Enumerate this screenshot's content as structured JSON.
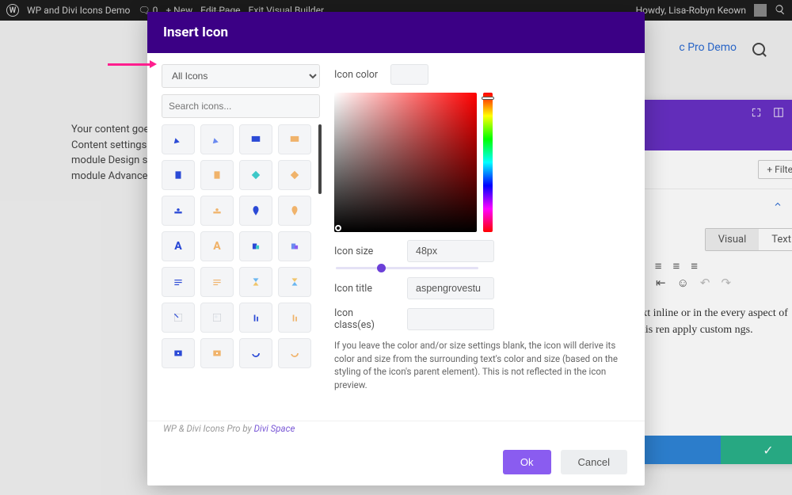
{
  "wpbar": {
    "site_title": "WP and Divi Icons Demo",
    "comments": "0",
    "new": "New",
    "edit_page": "Edit Page",
    "exit_vb": "Exit Visual Builder",
    "howdy": "Howdy, Lisa-Robyn Keown"
  },
  "page": {
    "demo_link": "c Pro Demo",
    "hint1": "Your content goe",
    "hint2": "Content settings.",
    "hint3": "module Design se",
    "hint4": "module Advance"
  },
  "editor": {
    "filter": "Filter",
    "tab_visual": "Visual",
    "tab_text": "Text",
    "body": "ext inline or in the every aspect of this ren apply custom ngs."
  },
  "modal": {
    "title": "Insert Icon",
    "category": "All Icons",
    "search_placeholder": "Search icons...",
    "label_color": "Icon color",
    "label_size": "Icon size",
    "size_value": "48px",
    "label_title": "Icon title",
    "title_value": "aspengrovestu",
    "label_classes": "Icon class(es)",
    "help": "If you leave the color and/or size settings blank, the icon will derive its color and size from the surrounding text's color and size (based on the styling of the icon's parent element). This is not reflected in the icon preview.",
    "credit_prefix": "WP & Divi Icons Pro by ",
    "credit_link": "Divi Space",
    "ok": "Ok",
    "cancel": "Cancel"
  }
}
